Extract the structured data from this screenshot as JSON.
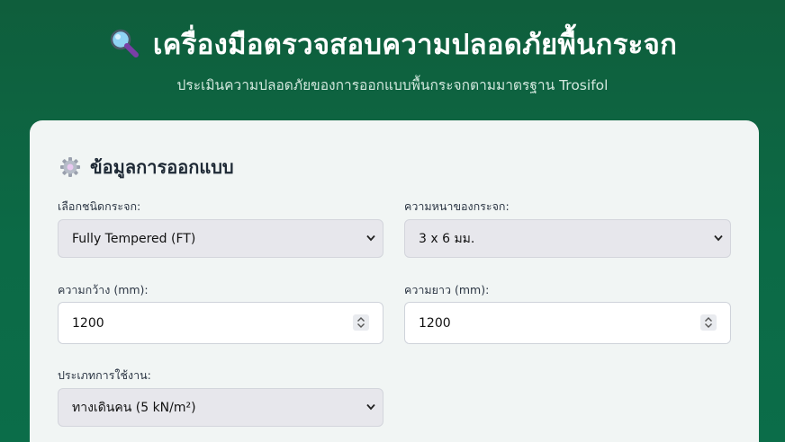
{
  "header": {
    "title": "เครื่องมือตรวจสอบความปลอดภัยพื้นกระจก",
    "subtitle": "ประเมินความปลอดภัยของการออกแบบพื้นกระจกตามมาตรฐาน Trosifol",
    "title_icon": "magnifying-glass-icon"
  },
  "section": {
    "title": "ข้อมูลการออกแบบ",
    "icon": "gear-icon"
  },
  "form": {
    "glass_type": {
      "label": "เลือกชนิดกระจก:",
      "value": "Fully Tempered (FT)"
    },
    "thickness": {
      "label": "ความหนาของกระจก:",
      "value": "3 x 6 มม."
    },
    "width": {
      "label": "ความกว้าง (mm):",
      "value": "1200"
    },
    "length": {
      "label": "ความยาว (mm):",
      "value": "1200"
    },
    "usage": {
      "label": "ประเภทการใช้งาน:",
      "value": "ทางเดินคน (5 kN/m²)"
    }
  },
  "colors": {
    "background": "#0c6a46",
    "card": "#f1f5f4",
    "select_bg": "#e7e7ec"
  }
}
